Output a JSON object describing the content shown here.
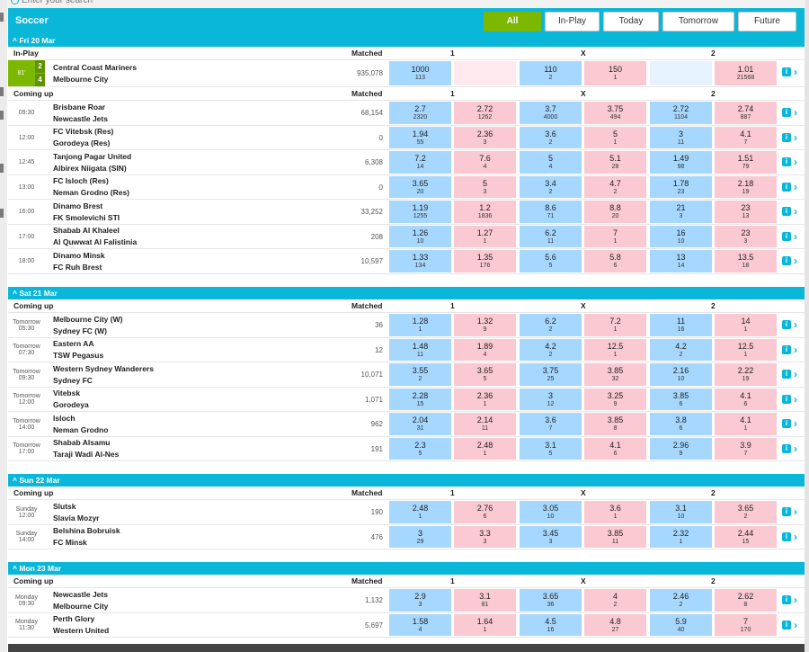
{
  "search": {
    "placeholder": "Enter your search"
  },
  "header": {
    "sport": "Soccer",
    "filters": [
      "All",
      "In-Play",
      "Today",
      "Tomorrow",
      "Future"
    ],
    "active_filter": "All"
  },
  "col_headers": {
    "matched": "Matched",
    "one": "1",
    "x": "X",
    "two": "2",
    "in_play": "In-Play",
    "coming_up": "Coming up"
  },
  "days": [
    {
      "label": "Fri 20 Mar",
      "in_play": {
        "minute": "81'",
        "home_score": "2",
        "away_score": "4",
        "home": "Central Coast Mariners",
        "away": "Melbourne City",
        "matched": "935,078",
        "odds": [
          {
            "p": "1000",
            "s": "113"
          },
          {
            "p": "",
            "s": ""
          },
          {
            "p": "110",
            "s": "2"
          },
          {
            "p": "150",
            "s": "1"
          },
          {
            "p": "",
            "s": ""
          },
          {
            "p": "1.01",
            "s": "21568"
          }
        ]
      },
      "events": [
        {
          "time": "09:30",
          "home": "Brisbane Roar",
          "away": "Newcastle Jets",
          "matched": "68,154",
          "odds": [
            {
              "p": "2.7",
              "s": "2320"
            },
            {
              "p": "2.72",
              "s": "1262"
            },
            {
              "p": "3.7",
              "s": "4000"
            },
            {
              "p": "3.75",
              "s": "494"
            },
            {
              "p": "2.72",
              "s": "1104"
            },
            {
              "p": "2.74",
              "s": "887"
            }
          ]
        },
        {
          "time": "12:00",
          "home": "FC Vitebsk (Res)",
          "away": "Gorodeya (Res)",
          "matched": "0",
          "odds": [
            {
              "p": "1.94",
              "s": "55"
            },
            {
              "p": "2.36",
              "s": "3"
            },
            {
              "p": "3.6",
              "s": "2"
            },
            {
              "p": "5",
              "s": "1"
            },
            {
              "p": "3",
              "s": "11"
            },
            {
              "p": "4.1",
              "s": "7"
            }
          ]
        },
        {
          "time": "12:45",
          "home": "Tanjong Pagar United",
          "away": "Albirex Niigata (SIN)",
          "matched": "6,308",
          "odds": [
            {
              "p": "7.2",
              "s": "14"
            },
            {
              "p": "7.6",
              "s": "4"
            },
            {
              "p": "5",
              "s": "4"
            },
            {
              "p": "5.1",
              "s": "28"
            },
            {
              "p": "1.49",
              "s": "98"
            },
            {
              "p": "1.51",
              "s": "79"
            }
          ]
        },
        {
          "time": "13:00",
          "home": "FC Isloch (Res)",
          "away": "Neman Grodno (Res)",
          "matched": "0",
          "odds": [
            {
              "p": "3.65",
              "s": "20"
            },
            {
              "p": "5",
              "s": "3"
            },
            {
              "p": "3.4",
              "s": "2"
            },
            {
              "p": "4.7",
              "s": "2"
            },
            {
              "p": "1.78",
              "s": "23"
            },
            {
              "p": "2.18",
              "s": "19"
            }
          ]
        },
        {
          "time": "16:00",
          "home": "Dinamo Brest",
          "away": "FK Smolevichi STI",
          "matched": "33,252",
          "odds": [
            {
              "p": "1.19",
              "s": "1255"
            },
            {
              "p": "1.2",
              "s": "1836"
            },
            {
              "p": "8.6",
              "s": "71"
            },
            {
              "p": "8.8",
              "s": "20"
            },
            {
              "p": "21",
              "s": "3"
            },
            {
              "p": "23",
              "s": "13"
            }
          ]
        },
        {
          "time": "17:00",
          "home": "Shabab Al Khaleel",
          "away": "Al Quwwat Al Falistinia",
          "matched": "208",
          "odds": [
            {
              "p": "1.26",
              "s": "10"
            },
            {
              "p": "1.27",
              "s": "1"
            },
            {
              "p": "6.2",
              "s": "11"
            },
            {
              "p": "7",
              "s": "1"
            },
            {
              "p": "16",
              "s": "10"
            },
            {
              "p": "23",
              "s": "3"
            }
          ]
        },
        {
          "time": "18:00",
          "home": "Dinamo Minsk",
          "away": "FC Ruh Brest",
          "matched": "10,597",
          "odds": [
            {
              "p": "1.33",
              "s": "134"
            },
            {
              "p": "1.35",
              "s": "176"
            },
            {
              "p": "5.6",
              "s": "5"
            },
            {
              "p": "5.8",
              "s": "6"
            },
            {
              "p": "13",
              "s": "14"
            },
            {
              "p": "13.5",
              "s": "18"
            }
          ]
        }
      ]
    },
    {
      "label": "Sat 21 Mar",
      "events": [
        {
          "day": "Tomorrow",
          "time": "05:30",
          "home": "Melbourne City (W)",
          "away": "Sydney FC (W)",
          "matched": "36",
          "odds": [
            {
              "p": "1.28",
              "s": "1"
            },
            {
              "p": "1.32",
              "s": "9"
            },
            {
              "p": "6.2",
              "s": "2"
            },
            {
              "p": "7.2",
              "s": "1"
            },
            {
              "p": "11",
              "s": "16"
            },
            {
              "p": "14",
              "s": "1"
            }
          ]
        },
        {
          "day": "Tomorrow",
          "time": "07:30",
          "home": "Eastern AA",
          "away": "TSW Pegasus",
          "matched": "12",
          "odds": [
            {
              "p": "1.48",
              "s": "11"
            },
            {
              "p": "1.89",
              "s": "4"
            },
            {
              "p": "4.2",
              "s": "2"
            },
            {
              "p": "12.5",
              "s": "1"
            },
            {
              "p": "4.2",
              "s": "2"
            },
            {
              "p": "12.5",
              "s": "1"
            }
          ]
        },
        {
          "day": "Tomorrow",
          "time": "09:30",
          "home": "Western Sydney Wanderers",
          "away": "Sydney FC",
          "matched": "10,071",
          "odds": [
            {
              "p": "3.55",
              "s": "2"
            },
            {
              "p": "3.65",
              "s": "5"
            },
            {
              "p": "3.75",
              "s": "25"
            },
            {
              "p": "3.85",
              "s": "32"
            },
            {
              "p": "2.16",
              "s": "10"
            },
            {
              "p": "2.22",
              "s": "19"
            }
          ]
        },
        {
          "day": "Tomorrow",
          "time": "12:00",
          "home": "Vitebsk",
          "away": "Gorodeya",
          "matched": "1,071",
          "odds": [
            {
              "p": "2.28",
              "s": "15"
            },
            {
              "p": "2.36",
              "s": "1"
            },
            {
              "p": "3",
              "s": "12"
            },
            {
              "p": "3.25",
              "s": "9"
            },
            {
              "p": "3.85",
              "s": "6"
            },
            {
              "p": "4.1",
              "s": "6"
            }
          ]
        },
        {
          "day": "Tomorrow",
          "time": "14:00",
          "home": "Isloch",
          "away": "Neman Grodno",
          "matched": "962",
          "odds": [
            {
              "p": "2.04",
              "s": "31"
            },
            {
              "p": "2.14",
              "s": "11"
            },
            {
              "p": "3.6",
              "s": "7"
            },
            {
              "p": "3.85",
              "s": "8"
            },
            {
              "p": "3.8",
              "s": "6"
            },
            {
              "p": "4.1",
              "s": "1"
            }
          ]
        },
        {
          "day": "Tomorrow",
          "time": "17:00",
          "home": "Shabab Alsamu",
          "away": "Taraji Wadi Al-Nes",
          "matched": "191",
          "odds": [
            {
              "p": "2.3",
              "s": "5"
            },
            {
              "p": "2.48",
              "s": "1"
            },
            {
              "p": "3.1",
              "s": "5"
            },
            {
              "p": "4.1",
              "s": "6"
            },
            {
              "p": "2.96",
              "s": "9"
            },
            {
              "p": "3.9",
              "s": "7"
            }
          ]
        }
      ]
    },
    {
      "label": "Sun 22 Mar",
      "events": [
        {
          "day": "Sunday",
          "time": "12:00",
          "home": "Slutsk",
          "away": "Slavia Mozyr",
          "matched": "190",
          "odds": [
            {
              "p": "2.48",
              "s": "1"
            },
            {
              "p": "2.76",
              "s": "6"
            },
            {
              "p": "3.05",
              "s": "10"
            },
            {
              "p": "3.6",
              "s": "1"
            },
            {
              "p": "3.1",
              "s": "10"
            },
            {
              "p": "3.65",
              "s": "2"
            }
          ]
        },
        {
          "day": "Sunday",
          "time": "14:00",
          "home": "Belshina Bobruisk",
          "away": "FC Minsk",
          "matched": "476",
          "odds": [
            {
              "p": "3",
              "s": "29"
            },
            {
              "p": "3.3",
              "s": "3"
            },
            {
              "p": "3.45",
              "s": "3"
            },
            {
              "p": "3.85",
              "s": "11"
            },
            {
              "p": "2.32",
              "s": "1"
            },
            {
              "p": "2.44",
              "s": "15"
            }
          ]
        }
      ]
    },
    {
      "label": "Mon 23 Mar",
      "events": [
        {
          "day": "Monday",
          "time": "09:30",
          "home": "Newcastle Jets",
          "away": "Melbourne City",
          "matched": "1,132",
          "odds": [
            {
              "p": "2.9",
              "s": "3"
            },
            {
              "p": "3.1",
              "s": "81"
            },
            {
              "p": "3.65",
              "s": "36"
            },
            {
              "p": "4",
              "s": "2"
            },
            {
              "p": "2.46",
              "s": "2"
            },
            {
              "p": "2.62",
              "s": "8"
            }
          ]
        },
        {
          "day": "Monday",
          "time": "11:30",
          "home": "Perth Glory",
          "away": "Western United",
          "matched": "5,697",
          "odds": [
            {
              "p": "1.58",
              "s": "4"
            },
            {
              "p": "1.64",
              "s": "1"
            },
            {
              "p": "4.5",
              "s": "16"
            },
            {
              "p": "4.8",
              "s": "27"
            },
            {
              "p": "5.9",
              "s": "40"
            },
            {
              "p": "7",
              "s": "170"
            }
          ]
        }
      ]
    }
  ],
  "icons": {
    "info": "i",
    "arrow": "›",
    "collapse": "^"
  },
  "colors": {
    "accent": "#0bb7d8",
    "active": "#7db800",
    "back": "#a6d8ff",
    "lay": "#fac9d1"
  }
}
